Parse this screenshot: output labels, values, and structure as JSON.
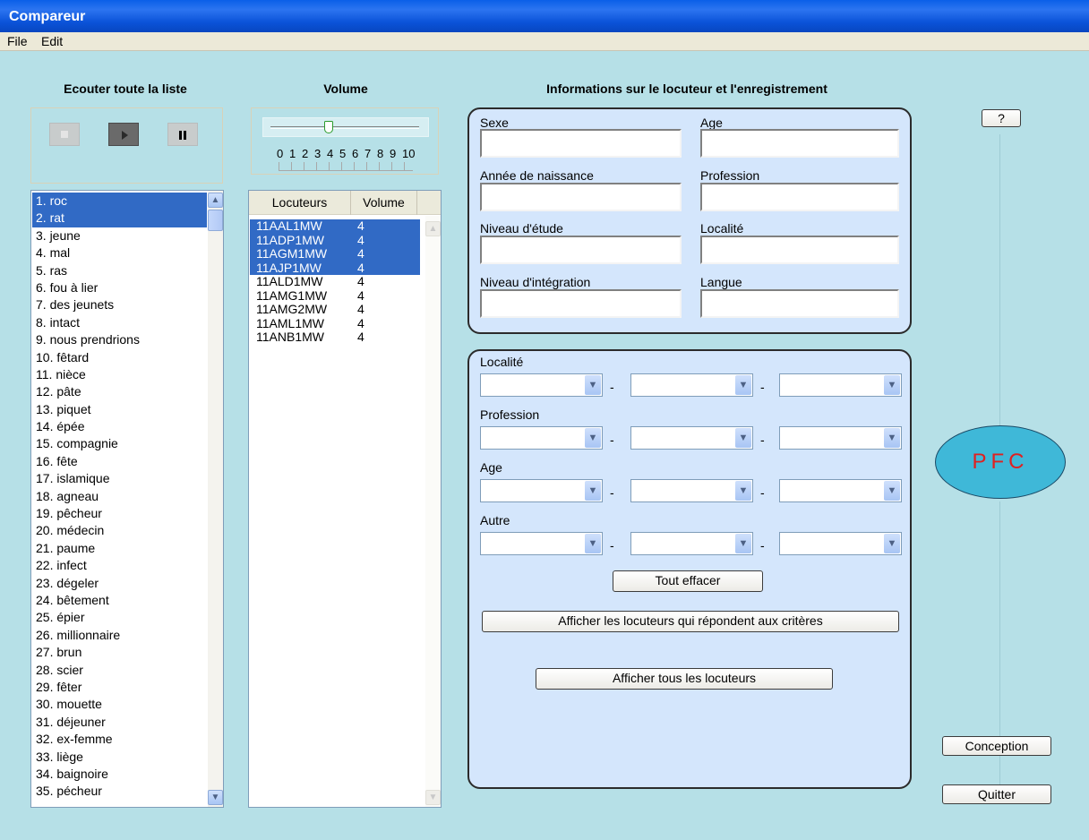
{
  "window": {
    "title": "Compareur"
  },
  "menu": [
    "File",
    "Edit"
  ],
  "player": {
    "title": "Ecouter toute la liste",
    "stop_icon": "stop-icon",
    "play_icon": "play-icon",
    "pause_icon": "pause-icon"
  },
  "volume": {
    "title": "Volume",
    "ticks": [
      "0",
      "1",
      "2",
      "3",
      "4",
      "5",
      "6",
      "7",
      "8",
      "9",
      "10"
    ],
    "level": 4
  },
  "words": [
    "1. roc",
    "2. rat",
    "3. jeune",
    "4. mal",
    "5. ras",
    "6. fou à lier",
    "7. des jeunets",
    "8. intact",
    "9. nous prendrions",
    "10. fêtard",
    "11. nièce",
    "12. pâte",
    "13. piquet",
    "14. épée",
    "15. compagnie",
    "16. fête",
    "17. islamique",
    "18. agneau",
    "19. pêcheur",
    "20. médecin",
    "21. paume",
    "22. infect",
    "23. dégeler",
    "24. bêtement",
    "25. épier",
    "26. millionnaire",
    "27. brun",
    "28. scier",
    "29. fêter",
    "30. mouette",
    "31. déjeuner",
    "32. ex-femme",
    "33. liège",
    "34. baignoire",
    "35. pécheur"
  ],
  "words_selected": [
    0,
    1
  ],
  "speakers": {
    "headers": [
      "Locuteurs",
      "Volume"
    ],
    "rows": [
      [
        "11AAL1MW",
        "4"
      ],
      [
        "11ADP1MW",
        "4"
      ],
      [
        "11AGM1MW",
        "4"
      ],
      [
        "11AJP1MW",
        "4"
      ],
      [
        "11ALD1MW",
        "4"
      ],
      [
        "11AMG1MW",
        "4"
      ],
      [
        "11AMG2MW",
        "4"
      ],
      [
        "11AML1MW",
        "4"
      ],
      [
        "11ANB1MW",
        "4"
      ]
    ],
    "selected": [
      0,
      1,
      2,
      3
    ]
  },
  "info": {
    "title": "Informations sur le locuteur et l'enregistrement",
    "sexe": "Sexe",
    "age": "Age",
    "annee": "Année de naissance",
    "profession": "Profession",
    "niveau_etude": "Niveau d'étude",
    "localite": "Localité",
    "niveau_integration": "Niveau d'intégration",
    "langue": "Langue"
  },
  "filters": {
    "localite": "Localité",
    "profession": "Profession",
    "age": "Age",
    "autre": "Autre",
    "dash": "-",
    "clear_button": "Tout effacer",
    "match_button": "Afficher les locuteurs qui répondent aux critères",
    "all_button": "Afficher tous les locuteurs"
  },
  "side": {
    "help_button": "?",
    "logo": "PFC",
    "conception_button": "Conception",
    "quit_button": "Quitter"
  },
  "colors": {
    "background": "#b6e0e7",
    "selection": "#316ac5",
    "title_bar": "#0a52d8",
    "logo_fill": "#3fb8d8",
    "logo_text": "#e02020"
  }
}
